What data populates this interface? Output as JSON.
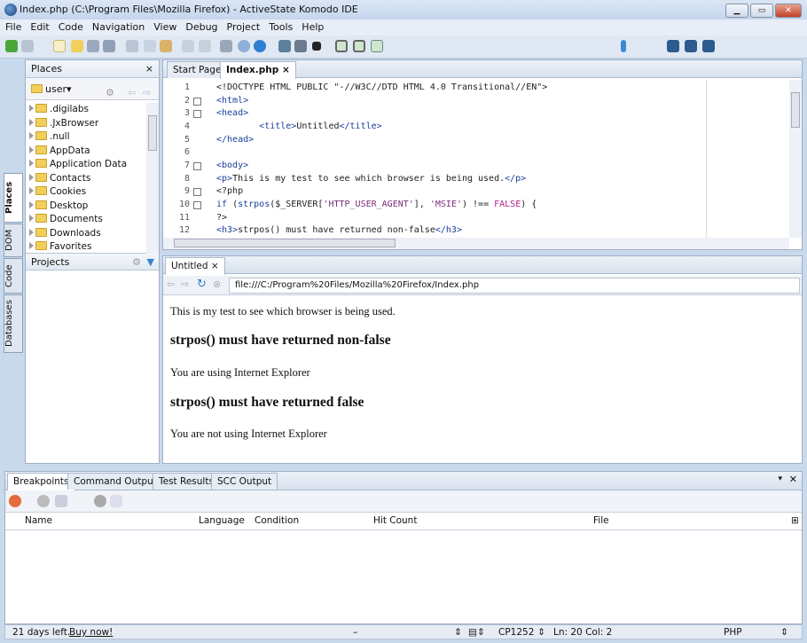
{
  "window": {
    "title": "Index.php (C:\\Program Files\\Mozilla Firefox) - ActiveState Komodo IDE"
  },
  "menu": [
    "File",
    "Edit",
    "Code",
    "Navigation",
    "View",
    "Debug",
    "Project",
    "Tools",
    "Help"
  ],
  "side_tabs": [
    "Places",
    "DOM",
    "Code",
    "Databases"
  ],
  "places": {
    "title": "Places",
    "close": "×",
    "root": "user",
    "items": [
      ".digilabs",
      ".JxBrowser",
      ".null",
      "AppData",
      "Application Data",
      "Contacts",
      "Cookies",
      "Desktop",
      "Documents",
      "Downloads",
      "Favorites"
    ],
    "projects_title": "Projects"
  },
  "editor": {
    "tabs": [
      {
        "label": "Start Page"
      },
      {
        "label": "Index.php ×"
      }
    ],
    "lines": [
      [
        [
          "p",
          "<!DOCTYPE HTML PUBLIC \"-//W3C//DTD HTML 4.0 Transitional//EN\">"
        ]
      ],
      [
        [
          "k",
          "<html>"
        ]
      ],
      [
        [
          "k",
          "<head>"
        ]
      ],
      [
        [
          "p",
          "        "
        ],
        [
          "k",
          "<title>"
        ],
        [
          "p",
          "Untitled"
        ],
        [
          "k",
          "</title>"
        ]
      ],
      [
        [
          "k",
          "</head>"
        ]
      ],
      [
        [
          "p",
          ""
        ]
      ],
      [
        [
          "k",
          "<body>"
        ]
      ],
      [
        [
          "k",
          "<p>"
        ],
        [
          "p",
          "This is my test to see which browser is being used."
        ],
        [
          "k",
          "</p>"
        ]
      ],
      [
        [
          "p",
          "<?php"
        ]
      ],
      [
        [
          "k",
          "if"
        ],
        [
          "p",
          " ("
        ],
        [
          "k",
          "strpos"
        ],
        [
          "p",
          "($_SERVER["
        ],
        [
          "s",
          "'HTTP_USER_AGENT'"
        ],
        [
          "p",
          "], "
        ],
        [
          "s",
          "'MSIE'"
        ],
        [
          "p",
          ") !== "
        ],
        [
          "f",
          "FALSE"
        ],
        [
          "p",
          ") {"
        ]
      ],
      [
        [
          "p",
          "?>"
        ]
      ],
      [
        [
          "k",
          "<h3>"
        ],
        [
          "p",
          "strpos() must have returned non-false"
        ],
        [
          "k",
          "</h3>"
        ]
      ]
    ]
  },
  "browser": {
    "tab": "Untitled ×",
    "url": "file:///C:/Program%20Files/Mozilla%20Firefox/Index.php",
    "content": {
      "p1": "This is my test to see which browser is being used.",
      "h1": "strpos() must have returned non-false",
      "p2": "You are using Internet Explorer",
      "h2": "strpos() must have returned false",
      "p3": "You are not using Internet Explorer"
    }
  },
  "bottom": {
    "tabs": [
      "Breakpoints",
      "Command Output",
      "Test Results",
      "SCC Output"
    ],
    "columns": [
      "Name",
      "Language",
      "Condition",
      "Hit Count",
      "File"
    ]
  },
  "status": {
    "trial": "21 days left.",
    "buy": "Buy now!",
    "sep": "–",
    "encoding": "CP1252",
    "position": "Ln: 20 Col: 2",
    "language": "PHP"
  }
}
